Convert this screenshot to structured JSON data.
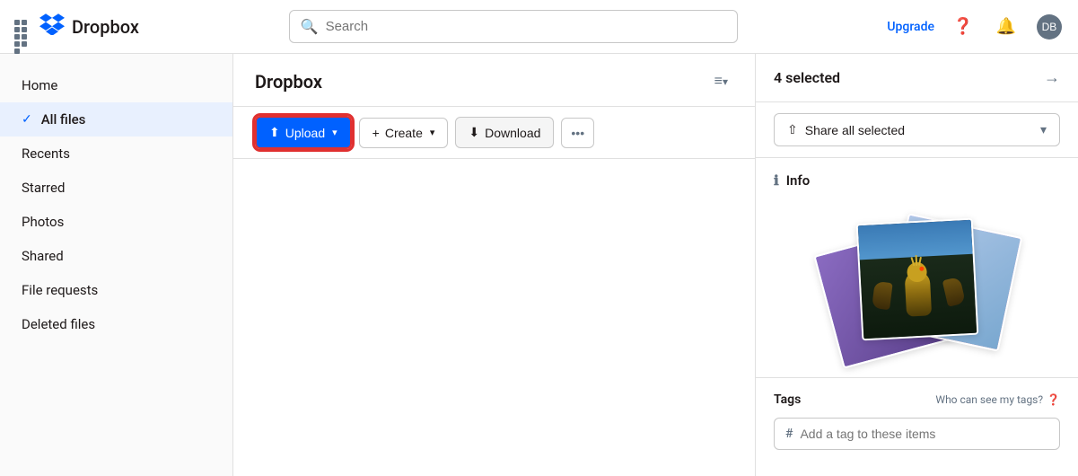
{
  "app": {
    "name": "Dropbox",
    "upgrade_label": "Upgrade"
  },
  "topbar": {
    "search_placeholder": "Search"
  },
  "sidebar": {
    "items": [
      {
        "id": "home",
        "label": "Home",
        "active": false
      },
      {
        "id": "all-files",
        "label": "All files",
        "active": true,
        "has_check": true
      },
      {
        "id": "recents",
        "label": "Recents",
        "active": false
      },
      {
        "id": "starred",
        "label": "Starred",
        "active": false
      },
      {
        "id": "photos",
        "label": "Photos",
        "active": false
      },
      {
        "id": "shared",
        "label": "Shared",
        "active": false
      },
      {
        "id": "file-requests",
        "label": "File requests",
        "active": false
      },
      {
        "id": "deleted-files",
        "label": "Deleted files",
        "active": false
      }
    ]
  },
  "content": {
    "title": "Dropbox",
    "toolbar": {
      "upload_label": "Upload",
      "create_label": "Create",
      "download_label": "Download"
    }
  },
  "right_panel": {
    "selected_count": "4 selected",
    "share_all_label": "Share all selected",
    "info_label": "Info",
    "tags_label": "Tags",
    "tags_help_label": "Who can see my tags?",
    "tag_placeholder": "Add a tag to these items"
  }
}
